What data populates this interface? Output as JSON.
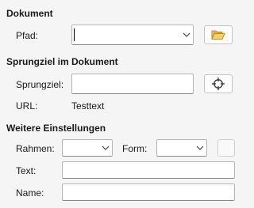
{
  "dokument": {
    "section_title": "Dokument",
    "pfad_label": "Pfad:",
    "pfad_value": ""
  },
  "sprungziel": {
    "section_title": "Sprungziel im Dokument",
    "sprungziel_label": "Sprungziel:",
    "sprungziel_value": "",
    "url_label": "URL:",
    "url_value": "Testtext"
  },
  "weitere": {
    "section_title": "Weitere Einstellungen",
    "rahmen_label": "Rahmen:",
    "rahmen_value": "",
    "form_label": "Form:",
    "form_value": "",
    "text_label": "Text:",
    "text_value": "",
    "name_label": "Name:",
    "name_value": ""
  },
  "icons": {
    "open_folder": "folder-open-icon",
    "target": "crosshair-target-icon",
    "dropdown": "chevron-down-icon",
    "accent_folder": "#e8a838"
  }
}
